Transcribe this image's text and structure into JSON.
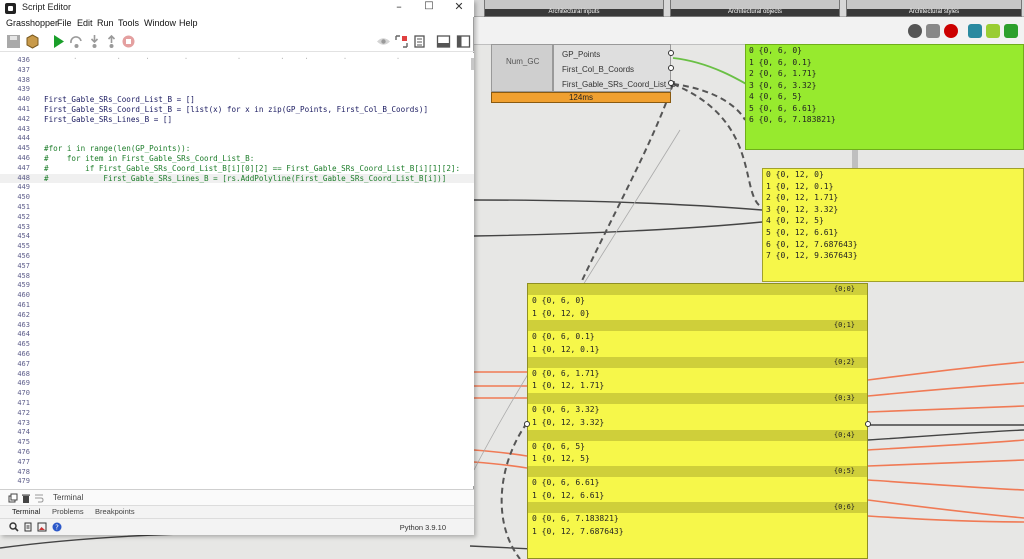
{
  "window": {
    "title": "Script Editor"
  },
  "menu": [
    "Grasshopper",
    "File",
    "Edit",
    "Run",
    "Tools",
    "Window",
    "Help"
  ],
  "code": {
    "ghost_line": "      .        .     .       .          .        .    .       .          .",
    "lines": [
      {
        "n": "436",
        "text": ""
      },
      {
        "n": "437",
        "text": ""
      },
      {
        "n": "438",
        "text": ""
      },
      {
        "n": "439",
        "text": ""
      },
      {
        "n": "440",
        "text": "First_Gable_SRs_Coord_List_B = []"
      },
      {
        "n": "441",
        "text": "First_Gable_SRs_Coord_List_B = [list(x) for x in zip(GP_Points, First_Col_B_Coords)]"
      },
      {
        "n": "442",
        "text": "First_Gable_SRs_Lines_B = []"
      },
      {
        "n": "443",
        "text": ""
      },
      {
        "n": "444",
        "text": ""
      },
      {
        "n": "445",
        "text": "#for i in range(len(GP_Points)):",
        "comment": true
      },
      {
        "n": "446",
        "text": "#    for item in First_Gable_SRs_Coord_List_B:",
        "comment": true
      },
      {
        "n": "447",
        "text": "#        if First_Gable_SRs_Coord_List_B[i][0][2] == First_Gable_SRs_Coord_List_B[i][1][2]:",
        "comment": true
      },
      {
        "n": "448",
        "text": "#            First_Gable_SRs_Lines_B = [rs.AddPolyline(First_Gable_SRs_Coord_List_B[i])]",
        "comment": true,
        "current": true
      },
      {
        "n": "449",
        "text": ""
      },
      {
        "n": "450",
        "text": ""
      },
      {
        "n": "451",
        "text": ""
      },
      {
        "n": "452",
        "text": ""
      },
      {
        "n": "453",
        "text": ""
      },
      {
        "n": "454",
        "text": ""
      },
      {
        "n": "455",
        "text": ""
      },
      {
        "n": "456",
        "text": ""
      },
      {
        "n": "457",
        "text": ""
      },
      {
        "n": "458",
        "text": ""
      },
      {
        "n": "459",
        "text": ""
      },
      {
        "n": "460",
        "text": ""
      },
      {
        "n": "461",
        "text": ""
      },
      {
        "n": "462",
        "text": ""
      },
      {
        "n": "463",
        "text": ""
      },
      {
        "n": "464",
        "text": ""
      },
      {
        "n": "465",
        "text": ""
      },
      {
        "n": "466",
        "text": ""
      },
      {
        "n": "467",
        "text": ""
      },
      {
        "n": "468",
        "text": ""
      },
      {
        "n": "469",
        "text": ""
      },
      {
        "n": "470",
        "text": ""
      },
      {
        "n": "471",
        "text": ""
      },
      {
        "n": "472",
        "text": ""
      },
      {
        "n": "473",
        "text": ""
      },
      {
        "n": "474",
        "text": ""
      },
      {
        "n": "475",
        "text": ""
      },
      {
        "n": "476",
        "text": ""
      },
      {
        "n": "477",
        "text": ""
      },
      {
        "n": "478",
        "text": ""
      },
      {
        "n": "479",
        "text": ""
      }
    ]
  },
  "terminal": {
    "label": "Terminal"
  },
  "bottom_tabs": [
    "Terminal",
    "Problems",
    "Breakpoints"
  ],
  "status": {
    "python_version": "Python 3.9.10"
  },
  "gh": {
    "ribbon_tabs": [
      "Architectural inputs",
      "Architectural objects",
      "Architectural styles"
    ],
    "component": {
      "input_label": "Num_GC",
      "outputs": [
        "GP_Points",
        "First_Col_B_Coords",
        "First_Gable_SRs_Coord_List_B"
      ],
      "timing": "124ms"
    },
    "panel_green": [
      "0 {0, 6, 0}",
      "1 {0, 6, 0.1}",
      "2 {0, 6, 1.71}",
      "3 {0, 6, 3.32}",
      "4 {0, 6, 5}",
      "5 {0, 6, 6.61}",
      "6 {0, 6, 7.183821}"
    ],
    "panel_y1": [
      "0 {0, 12, 0}",
      "1 {0, 12, 0.1}",
      "2 {0, 12, 1.71}",
      "3 {0, 12, 3.32}",
      "4 {0, 12, 5}",
      "5 {0, 12, 6.61}",
      "6 {0, 12, 7.687643}",
      "7 {0, 12, 9.367643}"
    ],
    "panel_y2": [
      {
        "path": "{0;0}",
        "items": [
          "0 {0, 6, 0}",
          "1 {0, 12, 0}"
        ]
      },
      {
        "path": "{0;1}",
        "items": [
          "0 {0, 6, 0.1}",
          "1 {0, 12, 0.1}"
        ]
      },
      {
        "path": "{0;2}",
        "items": [
          "0 {0, 6, 1.71}",
          "1 {0, 12, 1.71}"
        ]
      },
      {
        "path": "{0;3}",
        "items": [
          "0 {0, 6, 3.32}",
          "1 {0, 12, 3.32}"
        ]
      },
      {
        "path": "{0;4}",
        "items": [
          "0 {0, 6, 5}",
          "1 {0, 12, 5}"
        ]
      },
      {
        "path": "{0;5}",
        "items": [
          "0 {0, 6, 6.61}",
          "1 {0, 12, 6.61}"
        ]
      },
      {
        "path": "{0;6}",
        "items": [
          "0 {0, 6, 7.183821}",
          "1 {0, 12, 7.687643}"
        ]
      }
    ]
  },
  "colors": {
    "run_green": "#1a9f2a",
    "panel_green": "#97ea2e",
    "panel_yellow": "#f6f74a",
    "wire_orange": "#f07a55",
    "timing_bar": "#f0a030"
  }
}
